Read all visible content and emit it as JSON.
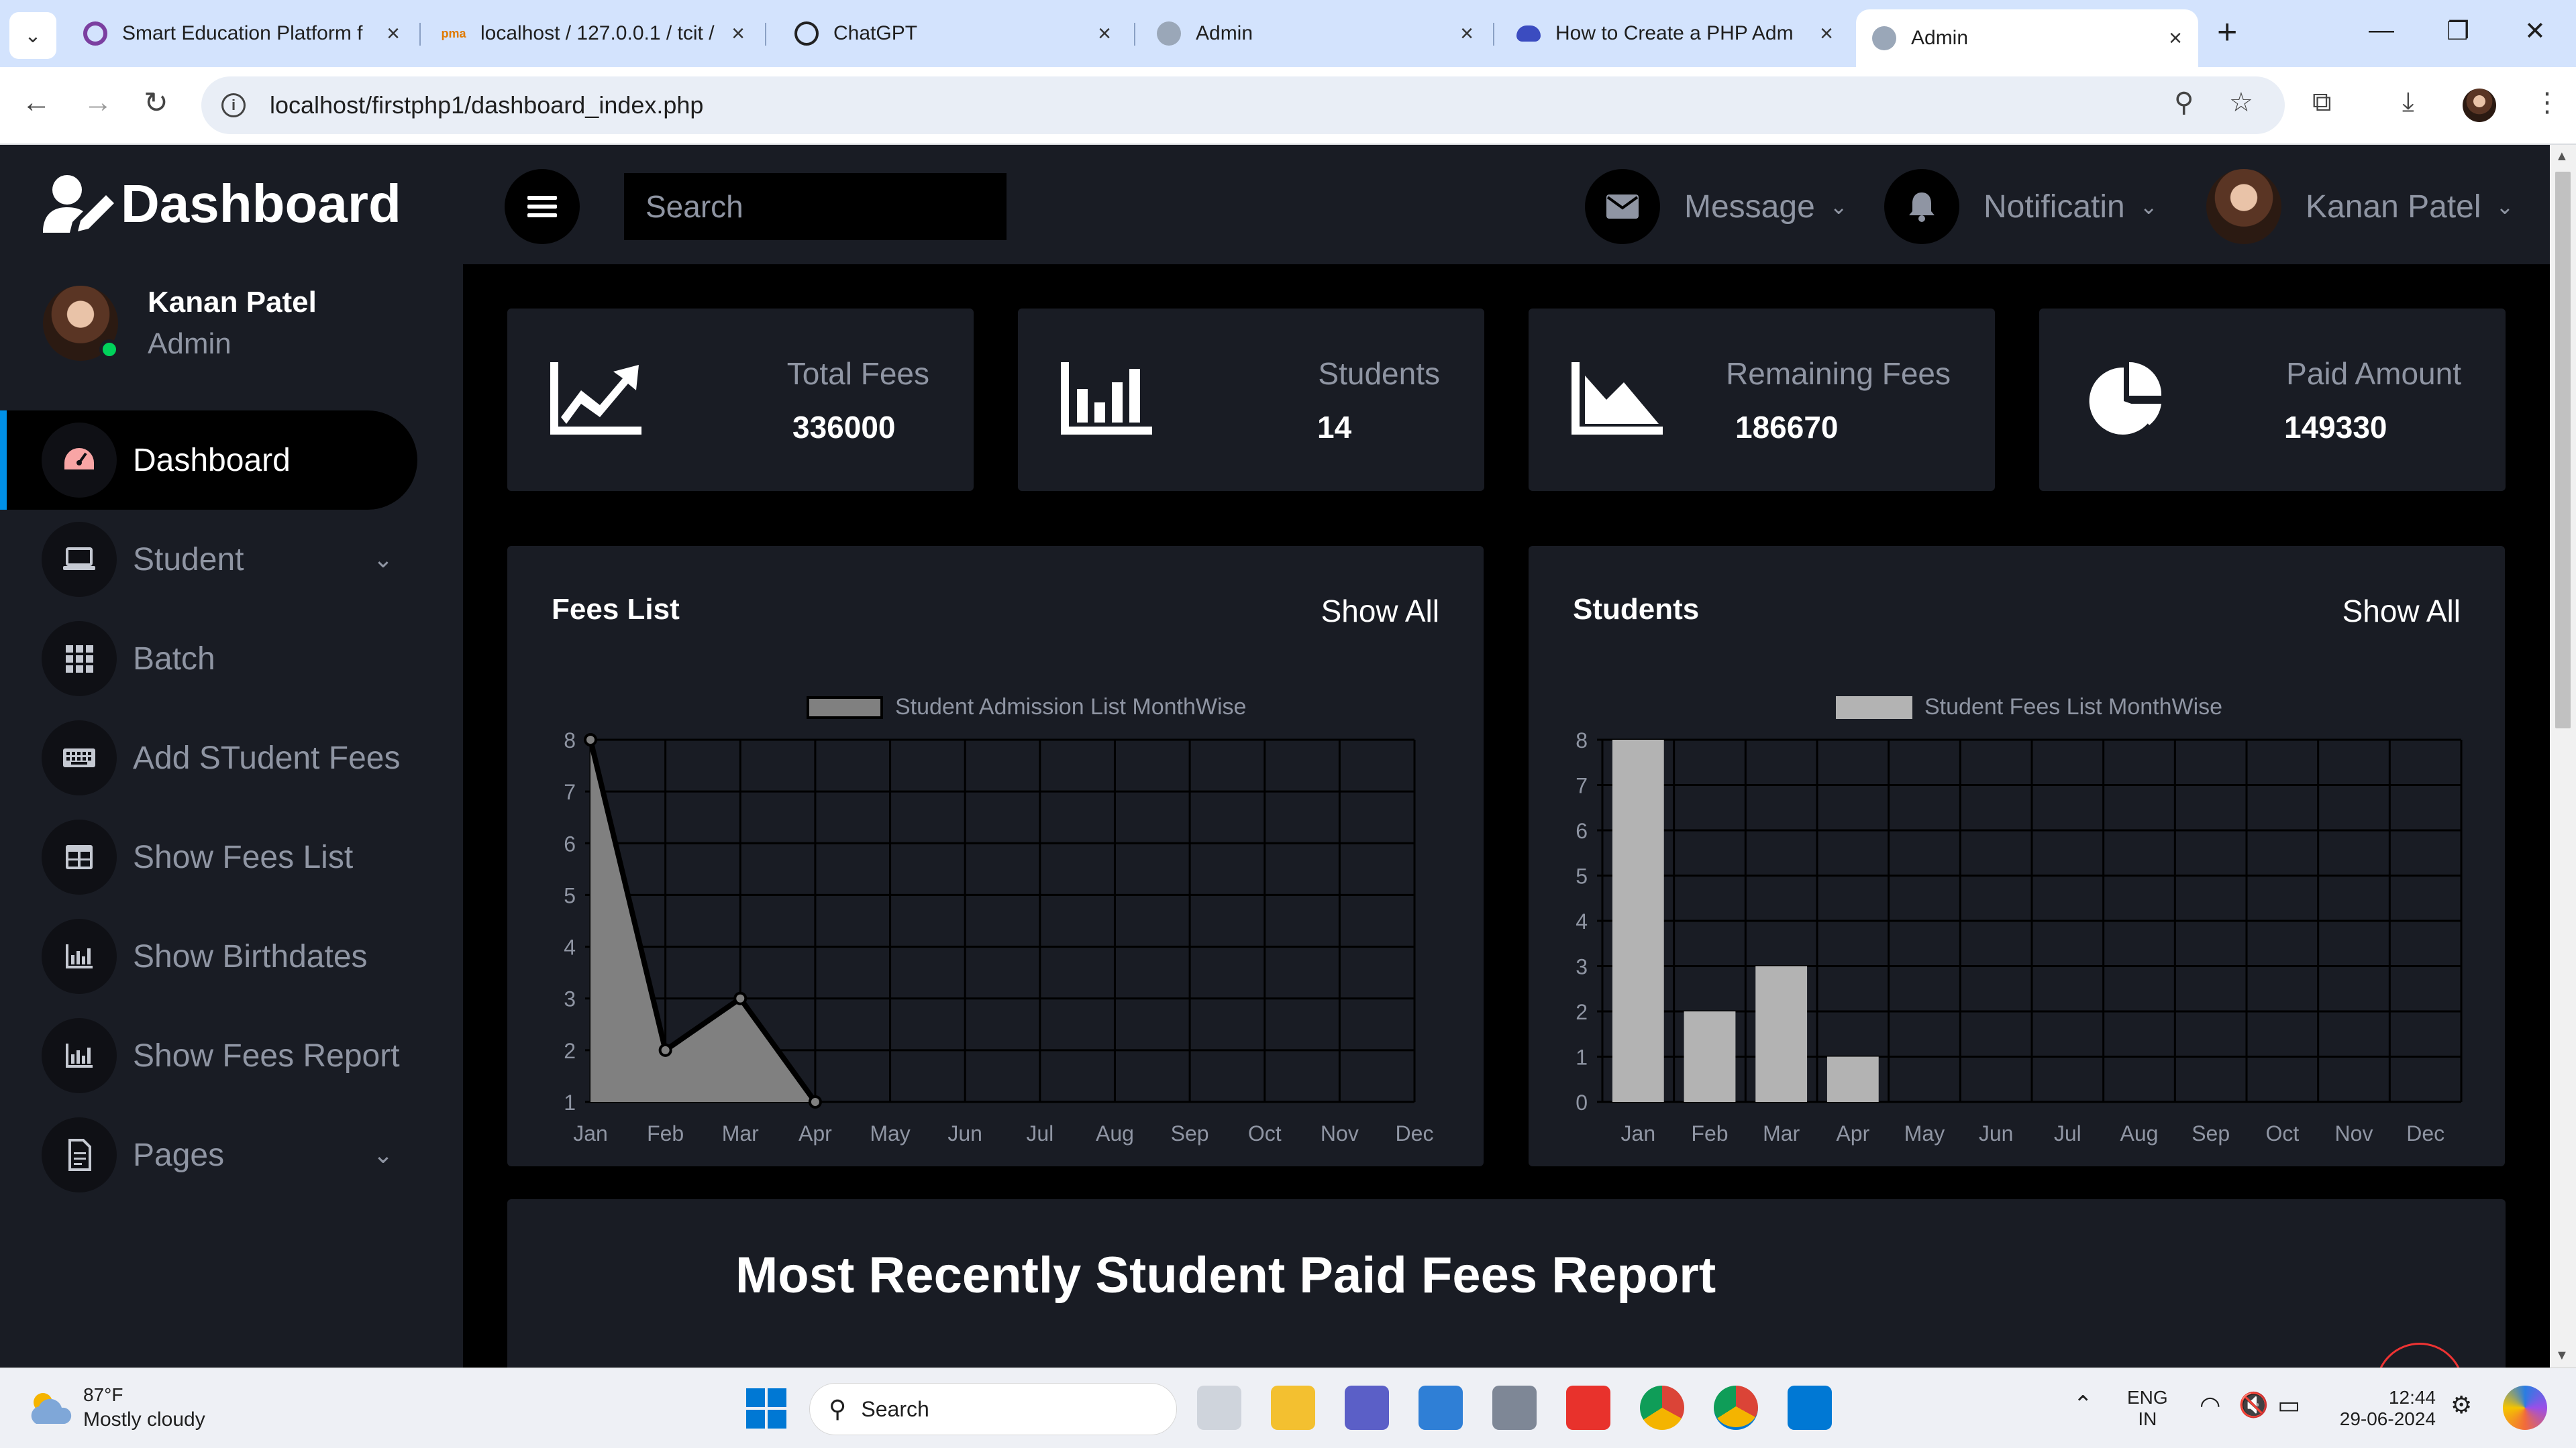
{
  "browser": {
    "tabs": [
      {
        "title": "Smart Education Platform f",
        "icon": "globe-purple-icon"
      },
      {
        "title": "localhost / 127.0.0.1 / tcit /",
        "icon": "phpmyadmin-icon"
      },
      {
        "title": "ChatGPT",
        "icon": "chatgpt-icon"
      },
      {
        "title": "Admin",
        "icon": "globe-icon"
      },
      {
        "title": "How to Create a PHP Adm",
        "icon": "cloud-icon"
      },
      {
        "title": "Admin",
        "icon": "globe-icon"
      }
    ],
    "new_tab": "+",
    "url": "localhost/firstphp1/dashboard_index.php"
  },
  "sidebar": {
    "brand": "Dashboard",
    "profile": {
      "name": "Kanan Patel",
      "role": "Admin"
    },
    "items": [
      {
        "label": "Dashboard",
        "icon": "speedometer-icon",
        "active": true,
        "has_children": false
      },
      {
        "label": "Student",
        "icon": "laptop-icon",
        "has_children": true
      },
      {
        "label": "Batch",
        "icon": "grid-icon",
        "has_children": false
      },
      {
        "label": "Add STudent Fees",
        "icon": "keyboard-icon",
        "has_children": false
      },
      {
        "label": "Show Fees List",
        "icon": "table-icon",
        "has_children": false
      },
      {
        "label": "Show Birthdates",
        "icon": "bar-chart-icon",
        "has_children": false
      },
      {
        "label": "Show Fees Report",
        "icon": "bar-chart-icon",
        "has_children": false
      },
      {
        "label": "Pages",
        "icon": "file-icon",
        "has_children": true
      }
    ]
  },
  "topbar": {
    "search_placeholder": "Search",
    "message_label": "Message",
    "notification_label": "Notificatin",
    "user_name": "Kanan Patel"
  },
  "stats": [
    {
      "label": "Total Fees",
      "value": "336000",
      "icon": "trend-chart-icon"
    },
    {
      "label": "Students",
      "value": "14",
      "icon": "bar-chart-icon"
    },
    {
      "label": "Remaining Fees",
      "value": "186670",
      "icon": "area-chart-icon"
    },
    {
      "label": "Paid Amount",
      "value": "149330",
      "icon": "pie-chart-icon"
    }
  ],
  "fees_card": {
    "title": "Fees List",
    "show_all": "Show All"
  },
  "students_card": {
    "title": "Students",
    "show_all": "Show All"
  },
  "chart_data": [
    {
      "type": "area",
      "legend": "Student Admission List MonthWise",
      "categories": [
        "Jan",
        "Feb",
        "Mar",
        "Apr",
        "May",
        "Jun",
        "Jul",
        "Aug",
        "Sep",
        "Oct",
        "Nov",
        "Dec"
      ],
      "values": [
        8,
        2,
        3,
        1
      ],
      "yticks": [
        1,
        2,
        3,
        4,
        5,
        6,
        7,
        8
      ],
      "ylim": [
        1,
        8
      ],
      "fill": "#808080",
      "line": "#000000",
      "grid": true
    },
    {
      "type": "bar",
      "legend": "Student Fees List MonthWise",
      "categories": [
        "Jan",
        "Feb",
        "Mar",
        "Apr",
        "May",
        "Jun",
        "Jul",
        "Aug",
        "Sep",
        "Oct",
        "Nov",
        "Dec"
      ],
      "values": [
        8,
        2,
        3,
        1
      ],
      "yticks": [
        0,
        1,
        2,
        3,
        4,
        5,
        6,
        7,
        8
      ],
      "ylim": [
        0,
        8
      ],
      "fill": "#b3b3b3",
      "grid": true
    }
  ],
  "report": {
    "title": "Most Recently Student Paid Fees Report"
  },
  "taskbar": {
    "weather_temp": "87°F",
    "weather_desc": "Mostly cloudy",
    "search_label": "Search",
    "lang_top": "ENG",
    "lang_bottom": "IN",
    "time": "12:44",
    "date": "29-06-2024"
  },
  "colors": {
    "sidebar_bg": "#191c24",
    "page_bg": "#000000",
    "accent": "#0090e7",
    "online": "#00d25b",
    "muted_text": "#8f95a3"
  }
}
